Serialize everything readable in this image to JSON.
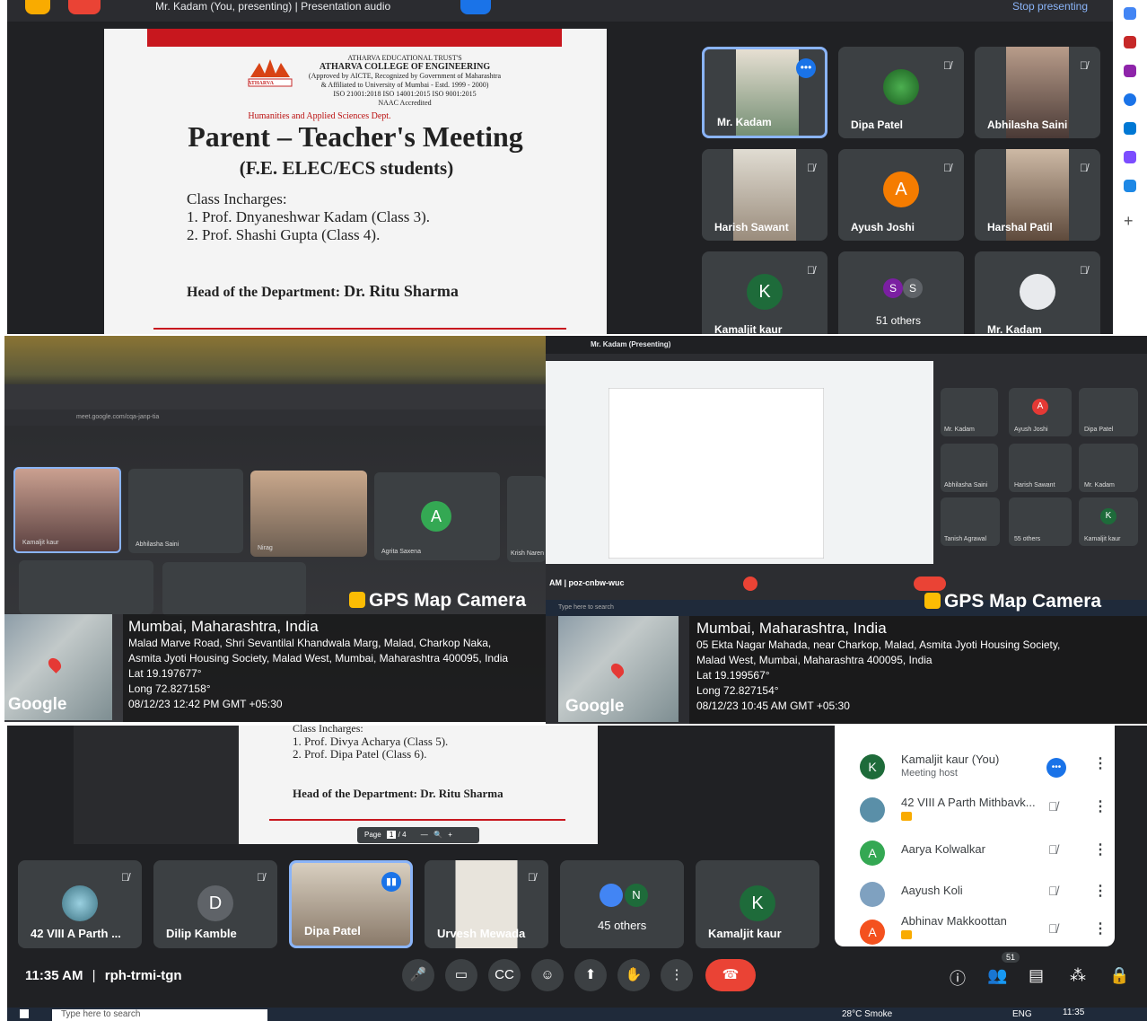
{
  "top_meet": {
    "presenter_title": "Mr. Kadam (You, presenting)",
    "separator": "|",
    "presentation_label": "Presentation audio",
    "stop_label": "Stop presenting",
    "slide": {
      "trust": "ATHARVA EDUCATIONAL TRUST'S",
      "college": "ATHARVA COLLEGE OF ENGINEERING",
      "approval1": "(Approved by AICTE, Recognized by Government of Maharashtra",
      "approval2": "& Affiliated to University of Mumbai - Estd. 1999 - 2000)",
      "iso": "ISO 21001:2018  ISO 14001:2015  ISO 9001:2015",
      "naac": "NAAC Accredited",
      "logo_text": "ATHARVA",
      "dept": "Humanities and Applied Sciences Dept.",
      "title": "Parent – Teacher's Meeting",
      "subtitle": "(F.E. ELEC/ECS students)",
      "incharges_label": "Class Incharges:",
      "incharge1": "1. Prof. Dnyaneshwar Kadam (Class 3).",
      "incharge2": "2. Prof. Shashi Gupta (Class 4).",
      "hod_label": "Head of the Department:",
      "hod_name": "Dr. Ritu Sharma"
    },
    "tiles": [
      {
        "name": "Mr. Kadam"
      },
      {
        "name": "Dipa Patel"
      },
      {
        "name": "Abhilasha Saini"
      },
      {
        "name": "Harish Sawant"
      },
      {
        "name": "Ayush Joshi",
        "initial": "A"
      },
      {
        "name": "Harshal Patil"
      },
      {
        "name": "Kamaljit kaur",
        "initial": "K"
      },
      {
        "name": "51 others",
        "initials": [
          "S",
          "S"
        ]
      },
      {
        "name": "Mr. Kadam"
      }
    ]
  },
  "gps_left": {
    "brand": "GPS Map Camera",
    "city": "Mumbai, Maharashtra, India",
    "address1": "Malad Marve Road, Shri Sevantilal Khandwala Marg, Malad, Charkop Naka,",
    "address2": "Asmita Jyoti Housing Society, Malad West, Mumbai, Maharashtra 400095, India",
    "lat": "Lat 19.197677°",
    "long": "Long 72.827158°",
    "datetime": "08/12/23 12:42 PM GMT +05:30",
    "map_brand": "Google",
    "meet_tiles": [
      {
        "name": "Kamaljit kaur"
      },
      {
        "name": "Abhilasha Saini"
      },
      {
        "name": "Nirag"
      },
      {
        "name": "Agrita Saxena",
        "initial": "A"
      },
      {
        "name": "Krish Naren"
      }
    ],
    "url": "meet.google.com/cqa-janp-tia"
  },
  "gps_right": {
    "brand": "GPS Map Camera",
    "city": "Mumbai, Maharashtra, India",
    "address1": "05 Ekta Nagar Mahada, near Charkop, Malad, Asmita Jyoti Housing Society,",
    "address2": "Malad West, Mumbai, Maharashtra 400095, India",
    "lat": "Lat 19.199567°",
    "long": "Long 72.827154°",
    "datetime": "08/12/23 10:45 AM GMT +05:30",
    "map_brand": "Google",
    "presenter": "Mr. Kadam (Presenting)",
    "meeting_code": "AM | poz-cnbw-wuc",
    "search_placeholder": "Type here to search",
    "meet_tiles": [
      {
        "name": "Mr. Kadam"
      },
      {
        "name": "Ayush Joshi",
        "initial": "A"
      },
      {
        "name": "Dipa Patel"
      },
      {
        "name": "Abhilasha Saini"
      },
      {
        "name": "Harish Sawant"
      },
      {
        "name": "Mr. Kadam"
      },
      {
        "name": "Tanish Agrawal"
      },
      {
        "name": "55 others"
      },
      {
        "name": "Kamaljit kaur",
        "initial": "K"
      }
    ]
  },
  "bottom_meet": {
    "slide": {
      "incharges_label": "Class Incharges:",
      "incharge1": "1. Prof. Divya Acharya (Class 5).",
      "incharge2": "2. Prof. Dipa Patel (Class 6).",
      "hod": "Head of the Department: Dr. Ritu Sharma"
    },
    "pager": {
      "label": "Page",
      "current": "1",
      "sep": "/",
      "total": "4"
    },
    "tiles": [
      {
        "name": "42 VIII A Parth ..."
      },
      {
        "name": "Dilip Kamble",
        "initial": "D"
      },
      {
        "name": "Dipa Patel"
      },
      {
        "name": "Urvesh Mewada"
      },
      {
        "name": "45 others",
        "initial": "N"
      },
      {
        "name": "Kamaljit kaur",
        "initial": "K"
      }
    ],
    "people": [
      {
        "name": "Kamaljit kaur (You)",
        "sub": "Meeting host",
        "initial": "K",
        "color": "#1e6b3a"
      },
      {
        "name": "42 VIII A Parth Mithbavk...",
        "sub": "",
        "initial": "",
        "color": "#5a8fa8"
      },
      {
        "name": "Aarya Kolwalkar",
        "sub": "",
        "initial": "A",
        "color": "#34a853"
      },
      {
        "name": "Aayush Koli",
        "sub": "",
        "initial": "",
        "color": "#7fa1c0"
      },
      {
        "name": "Abhinav Makkoottan",
        "sub": "",
        "initial": "A",
        "color": "#f4511e"
      }
    ],
    "participant_count": "51",
    "time": "11:35 AM",
    "meeting_code": "rph-trmi-tgn"
  },
  "taskbar": {
    "search_placeholder": "Type here to search",
    "weather": "28°C  Smoke",
    "lang": "ENG",
    "time": "11:35"
  },
  "colors": {
    "meet_bg": "#202124",
    "tile_bg": "#3c4043",
    "end_call": "#ea4335",
    "accent": "#8ab4f8"
  }
}
